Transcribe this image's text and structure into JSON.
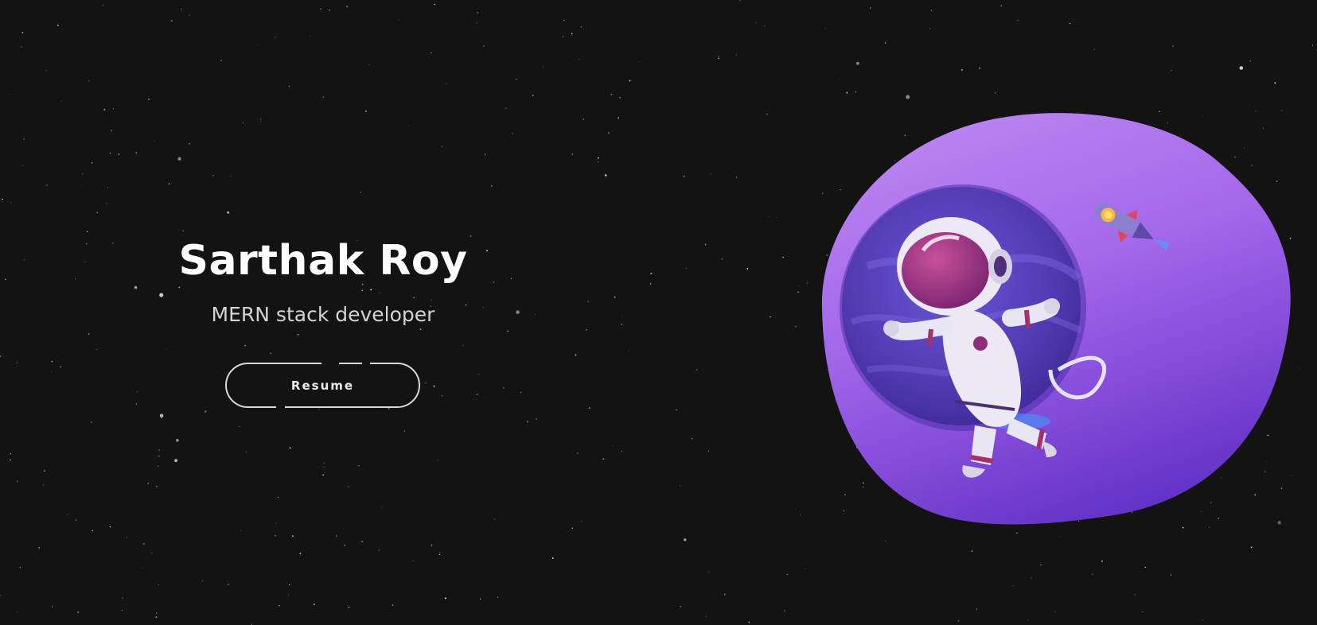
{
  "hero": {
    "name": "Sarthak Roy",
    "role": "MERN stack developer",
    "resume_label": "Resume"
  },
  "illustration": {
    "blob_icon": "purple-blob-backdrop",
    "planet_icon": "purple-planet-icon",
    "astronaut_icon": "astronaut-icon",
    "rocket_icon": "rocket-icon"
  },
  "colors": {
    "background": "#131313",
    "text_primary": "#ffffff",
    "text_secondary": "#d3d3d3",
    "button_border": "#d9d9d9",
    "blob_light": "#b57ef0",
    "blob_dark": "#6a35c9",
    "planet": "#5a3fbf"
  }
}
